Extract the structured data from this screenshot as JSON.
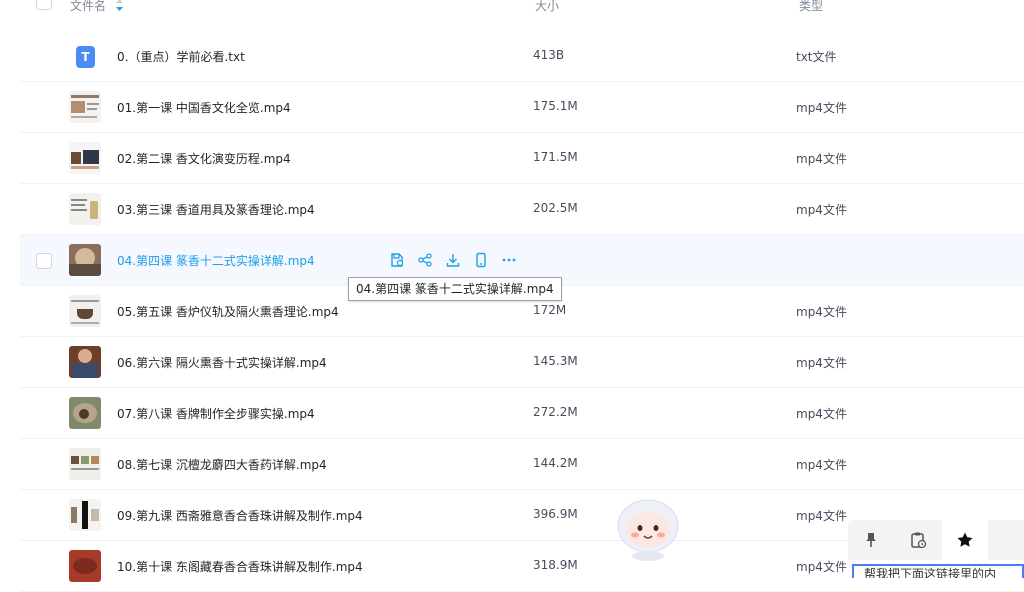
{
  "header": {
    "name_label": "文件名",
    "size_label": "大小",
    "type_label": "类型"
  },
  "files": [
    {
      "name": "0.（重点）学前必看.txt",
      "size": "413B",
      "type": "txt文件"
    },
    {
      "name": "01.第一课 中国香文化全览.mp4",
      "size": "175.1M",
      "type": "mp4文件"
    },
    {
      "name": "02.第二课 香文化演变历程.mp4",
      "size": "171.5M",
      "type": "mp4文件"
    },
    {
      "name": "03.第三课 香道用具及篆香理论.mp4",
      "size": "202.5M",
      "type": "mp4文件"
    },
    {
      "name": "04.第四课 篆香十二式实操详解.mp4",
      "size": "",
      "type": ""
    },
    {
      "name": "05.第五课 香炉仪轨及隔火熏香理论.mp4",
      "size": "172M",
      "type": "mp4文件"
    },
    {
      "name": "06.第六课 隔火熏香十式实操详解.mp4",
      "size": "145.3M",
      "type": "mp4文件"
    },
    {
      "name": "07.第八课 香牌制作全步骤实操.mp4",
      "size": "272.2M",
      "type": "mp4文件"
    },
    {
      "name": "08.第七课 沉檀龙麝四大香药详解.mp4",
      "size": "144.2M",
      "type": "mp4文件"
    },
    {
      "name": "09.第九课 西斋雅意香合香珠讲解及制作.mp4",
      "size": "396.9M",
      "type": "mp4文件"
    },
    {
      "name": "10.第十课 东阁藏春香合香珠讲解及制作.mp4",
      "size": "318.9M",
      "type": "mp4文件"
    }
  ],
  "tooltip": "04.第四课 篆香十二式实操详解.mp4",
  "assistant_input_partial": "帮我把下面这链接里的内",
  "colors": {
    "accent": "#1e9fe8",
    "icon": "#1e9fe8"
  },
  "icons": [
    "sort-icon",
    "save-icon",
    "share-icon",
    "download-icon",
    "phone-icon",
    "more-icon",
    "pin-icon",
    "clipboard-icon",
    "star-icon"
  ]
}
